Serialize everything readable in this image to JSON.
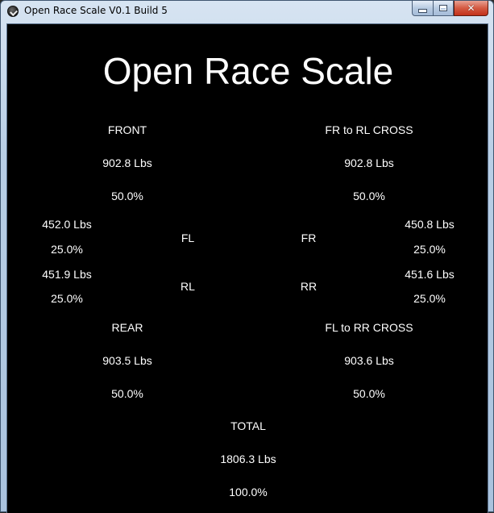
{
  "window": {
    "title": "Open Race Scale V0.1 Build 5",
    "close_glyph": "✕"
  },
  "app": {
    "title": "Open Race Scale"
  },
  "front": {
    "label": "FRONT",
    "weight": "902.8 Lbs",
    "percent": "50.0%"
  },
  "fr_rl_cross": {
    "label": "FR to RL CROSS",
    "weight": "902.8 Lbs",
    "percent": "50.0%"
  },
  "corners": {
    "fl": {
      "label": "FL",
      "weight": "452.0 Lbs",
      "percent": "25.0%"
    },
    "fr": {
      "label": "FR",
      "weight": "450.8 Lbs",
      "percent": "25.0%"
    },
    "rl": {
      "label": "RL",
      "weight": "451.9 Lbs",
      "percent": "25.0%"
    },
    "rr": {
      "label": "RR",
      "weight": "451.6 Lbs",
      "percent": "25.0%"
    }
  },
  "rear": {
    "label": "REAR",
    "weight": "903.5 Lbs",
    "percent": "50.0%"
  },
  "fl_rr_cross": {
    "label": "FL to RR CROSS",
    "weight": "903.6 Lbs",
    "percent": "50.0%"
  },
  "total": {
    "label": "TOTAL",
    "weight": "1806.3 Lbs",
    "percent": "100.0%"
  },
  "icons": {
    "app_icon": "app-logo-icon",
    "minimize": "minimize-icon",
    "maximize": "maximize-icon",
    "close": "close-icon"
  }
}
